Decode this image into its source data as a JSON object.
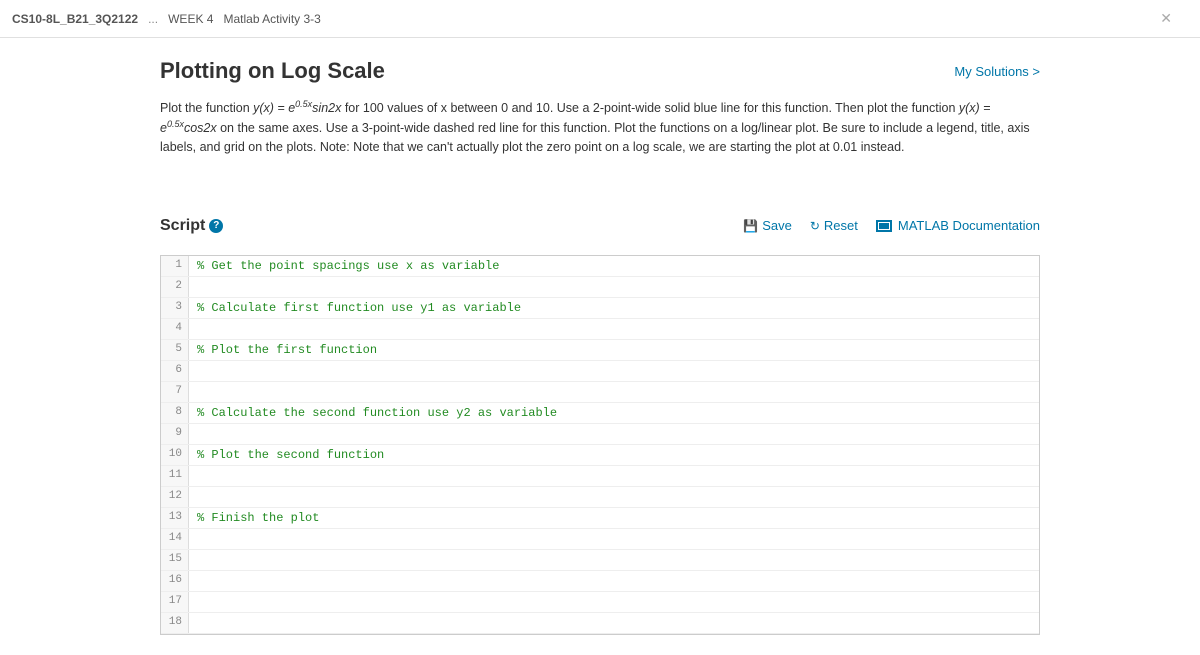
{
  "breadcrumb": {
    "course": "CS10-8L_B21_3Q2122",
    "ellipsis": "...",
    "week": "WEEK 4",
    "activity": "Matlab Activity 3-3"
  },
  "title": "Plotting on Log Scale",
  "solutions_link": "My Solutions >",
  "description": {
    "part1": "Plot the function  ",
    "func1_lhs": "y(x) = e",
    "func1_exp": "0.5x",
    "func1_rhs": "sin2x",
    "part2": " for 100 values of x between 0 and 10. Use a 2-point-wide solid blue line for this function. Then plot the function  ",
    "func2_lhs": "y(x) = e",
    "func2_exp": "0.5x",
    "func2_rhs": "cos2x",
    "part3": " on the same axes. Use a 3-point-wide dashed red line for this function. Plot the functions on a log/linear plot. Be sure to include a legend, title, axis labels, and grid on the plots. Note: Note that we can't actually plot the zero point on a log scale, we are starting the plot at 0.01 instead."
  },
  "script": {
    "label": "Script",
    "help": "?",
    "save": "Save",
    "reset": "Reset",
    "doc": "MATLAB Documentation"
  },
  "editor": {
    "lines": [
      {
        "n": "1",
        "text": "% Get the point spacings use x as variable",
        "cls": "comment"
      },
      {
        "n": "2",
        "text": "",
        "cls": ""
      },
      {
        "n": "3",
        "text": "% Calculate first function use y1 as variable",
        "cls": "comment"
      },
      {
        "n": "4",
        "text": "",
        "cls": ""
      },
      {
        "n": "5",
        "text": "% Plot the first function",
        "cls": "comment"
      },
      {
        "n": "6",
        "text": "",
        "cls": ""
      },
      {
        "n": "7",
        "text": "",
        "cls": ""
      },
      {
        "n": "8",
        "text": "% Calculate the second function use y2 as variable",
        "cls": "comment"
      },
      {
        "n": "9",
        "text": "",
        "cls": ""
      },
      {
        "n": "10",
        "text": "% Plot the second function",
        "cls": "comment"
      },
      {
        "n": "11",
        "text": "",
        "cls": ""
      },
      {
        "n": "12",
        "text": "",
        "cls": ""
      },
      {
        "n": "13",
        "text": "% Finish the plot",
        "cls": "comment"
      },
      {
        "n": "14",
        "text": "",
        "cls": ""
      },
      {
        "n": "15",
        "text": "",
        "cls": ""
      },
      {
        "n": "16",
        "text": "",
        "cls": ""
      },
      {
        "n": "17",
        "text": "",
        "cls": ""
      },
      {
        "n": "18",
        "text": "",
        "cls": ""
      }
    ]
  }
}
